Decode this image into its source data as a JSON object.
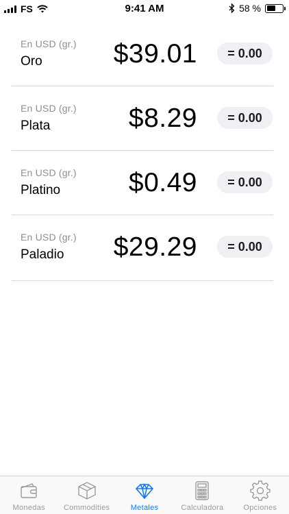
{
  "status_bar": {
    "carrier": "FS",
    "time": "9:41 AM",
    "battery_percent": "58 %",
    "battery_level": 0.58
  },
  "metals": [
    {
      "unit_label": "En USD (gr.)",
      "name": "Oro",
      "price": "$39.01",
      "converted": "= 0.00"
    },
    {
      "unit_label": "En USD (gr.)",
      "name": "Plata",
      "price": "$8.29",
      "converted": "= 0.00"
    },
    {
      "unit_label": "En USD (gr.)",
      "name": "Platino",
      "price": "$0.49",
      "converted": "= 0.00"
    },
    {
      "unit_label": "En USD (gr.)",
      "name": "Paladio",
      "price": "$29.29",
      "converted": "= 0.00"
    }
  ],
  "tab_bar": {
    "active_color": "#1779e4",
    "inactive_color": "#9b9b9b",
    "tabs": [
      {
        "label": "Monedas",
        "icon": "wallet-icon",
        "active": false
      },
      {
        "label": "Commodities",
        "icon": "box-icon",
        "active": false
      },
      {
        "label": "Metales",
        "icon": "diamond-icon",
        "active": true
      },
      {
        "label": "Calculadora",
        "icon": "calculator-icon",
        "active": false
      },
      {
        "label": "Opciones",
        "icon": "gear-icon",
        "active": false
      }
    ]
  }
}
